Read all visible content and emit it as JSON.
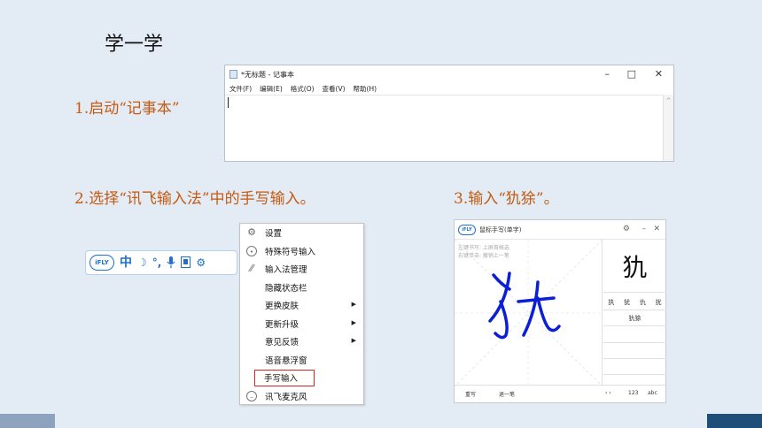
{
  "title": "学一学",
  "steps": {
    "step1": "1.启动“记事本”",
    "step2": "2.选择“讯飞输入法”中的手写输入。",
    "step3": "3.输入“犰狳”。"
  },
  "notepad": {
    "title": "*无标题 - 记事本",
    "controls": {
      "min": "–",
      "max": "□",
      "close": "✕"
    },
    "menu": [
      "文件(F)",
      "编辑(E)",
      "格式(O)",
      "查看(V)",
      "帮助(H)"
    ],
    "scroll_up": "^"
  },
  "ime_bar": {
    "logo": "iFLY",
    "icons": [
      "中",
      "moon-icon",
      "punctuation-icon",
      "microphone-icon",
      "keyboard-icon",
      "gear-icon"
    ]
  },
  "context_menu": {
    "items": [
      {
        "label": "设置",
        "icon": "gear-icon",
        "submenu": false
      },
      {
        "label": "特殊符号输入",
        "icon": "circle-icon",
        "submenu": false
      },
      {
        "label": "输入法管理",
        "icon": "manage-icon",
        "submenu": false
      },
      {
        "label": "隐藏状态栏",
        "icon": "",
        "submenu": false
      },
      {
        "label": "更换皮肤",
        "icon": "",
        "submenu": true
      },
      {
        "label": "更新升级",
        "icon": "",
        "submenu": true
      },
      {
        "label": "意见反馈",
        "icon": "",
        "submenu": true
      },
      {
        "label": "语音悬浮窗",
        "icon": "",
        "submenu": false
      },
      {
        "label": "手写输入",
        "icon": "",
        "submenu": false,
        "highlighted": true
      },
      {
        "label": "讯飞麦克风",
        "icon": "mic-circle-icon",
        "submenu": false
      }
    ],
    "arrow": "▶"
  },
  "handwriting": {
    "title": "鼠标手写(单字)",
    "logo": "iFLY",
    "controls": {
      "gear": "⚙",
      "min": "–",
      "close": "✕"
    },
    "hints": [
      "左键书写: 上屏首候选",
      "右键单击: 撤销上一笔"
    ],
    "big_candidate": "犰",
    "candidates": [
      "执",
      "犹",
      "仇",
      "扰"
    ],
    "word": "犰狳",
    "buttons": {
      "rewrite": "重写",
      "undo": "退一笔",
      "nav": "‹ ›",
      "num": "123",
      "abc": "abc"
    },
    "stroke_color": "#0b1fd6"
  },
  "colors": {
    "accent": "#c55a11",
    "footer_left": "#8fa2bd",
    "footer_right": "#1f4e79"
  }
}
